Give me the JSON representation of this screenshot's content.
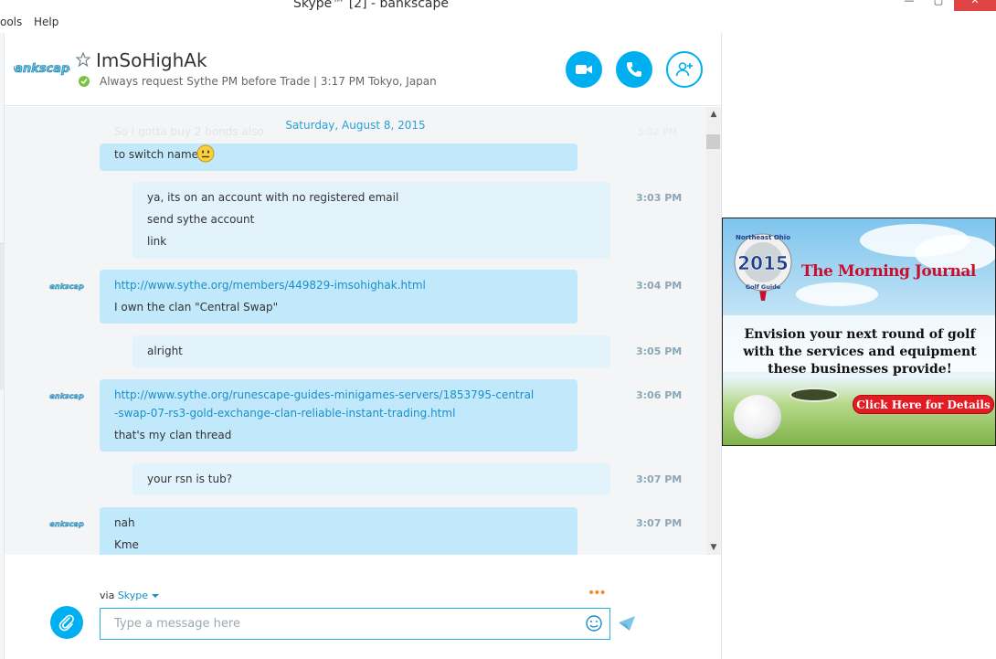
{
  "window": {
    "title": "Skype™ [2] - bankscape",
    "menu": [
      "ools",
      "Help"
    ]
  },
  "header": {
    "avatar_text": "bankscape",
    "contact_name": "ImSoHighAk",
    "mood": "Always request Sythe PM before Trade  |  3:17 PM Tokyo, Japan",
    "status": "online"
  },
  "conversation": {
    "date_separator": "Saturday, August 8, 2015",
    "faded_text": "So I gotta buy 2 bonds also",
    "messages": [
      {
        "from": "contact",
        "time": "",
        "lines": [
          "to switch name"
        ]
      },
      {
        "from": "me",
        "time": "3:03 PM",
        "lines": [
          "ya, its on an account with no registered email",
          "send sythe account",
          "link"
        ]
      },
      {
        "from": "contact",
        "time": "3:04 PM",
        "lines": [
          "http://www.sythe.org/members/449829-imsohighak.html",
          "I own the clan \"Central Swap\""
        ]
      },
      {
        "from": "me",
        "time": "3:05 PM",
        "lines": [
          "alright"
        ]
      },
      {
        "from": "contact",
        "time": "3:06 PM",
        "lines": [
          "http://www.sythe.org/runescape-guides-minigames-servers/1853795-central",
          "-swap-07-rs3-gold-exchange-clan-reliable-instant-trading.html",
          "that's my clan thread"
        ]
      },
      {
        "from": "me",
        "time": "3:07 PM",
        "lines": [
          "your rsn is tub?"
        ]
      },
      {
        "from": "contact",
        "time": "3:07 PM",
        "lines": [
          "nah",
          "Kme"
        ]
      }
    ]
  },
  "compose": {
    "via_label": "via",
    "via_service": "Skype",
    "placeholder": "Type a message here",
    "more_dots": "•••"
  },
  "ad": {
    "badge_region": "Northeast Ohio",
    "badge_year": "2015",
    "badge_guide": "Golf Guide",
    "brand": "The Morning Journal",
    "headline_lines": [
      "Envision your next round of golf",
      "with the services and equipment",
      "these businesses provide!"
    ],
    "cta": "Click Here for Details"
  },
  "colors": {
    "skype_blue": "#00aff0",
    "incoming_bubble": "#c2e9fb",
    "outgoing_bubble": "#e2f3fb",
    "link": "#1a8fc9",
    "status_online": "#7cc242",
    "ad_red": "#e31b23"
  }
}
